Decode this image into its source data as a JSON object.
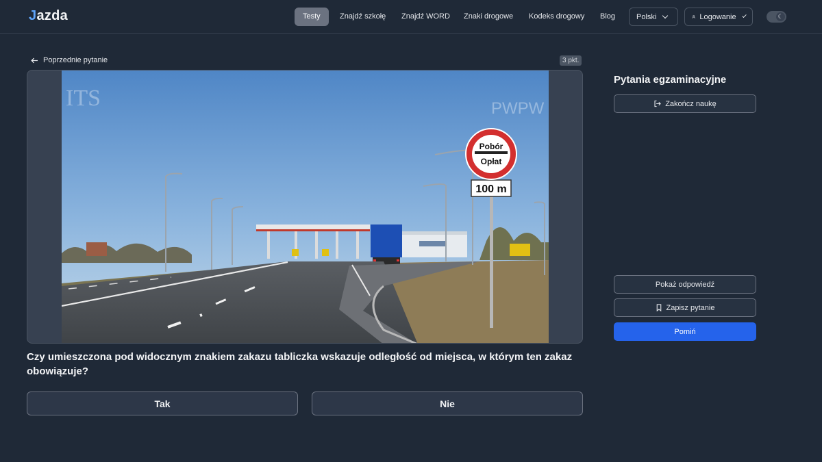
{
  "header": {
    "logo": {
      "initial": "J",
      "rest": "azda"
    },
    "nav": [
      {
        "label": "Testy",
        "active": true
      },
      {
        "label": "Znajdź szkołę"
      },
      {
        "label": "Znajdź WORD"
      },
      {
        "label": "Znaki drogowe"
      },
      {
        "label": "Kodeks drogowy"
      },
      {
        "label": "Blog"
      }
    ],
    "language_label": "Polski",
    "login_label": "Logowanie",
    "theme_icon": "moon-icon"
  },
  "question": {
    "prev_label": "Poprzednie pytanie",
    "points": "3 pkt.",
    "text": "Czy umieszczona pod widocznym znakiem zakazu tabliczka wskazuje odległość od miejsca, w którym ten zakaz obowiązuje?",
    "answers": [
      "Tak",
      "Nie"
    ],
    "image": {
      "sign_line1": "Pobór",
      "sign_line2": "Opłat",
      "plate": "100 m",
      "watermark_left": "ITS",
      "watermark_right": "PWPW"
    }
  },
  "sidebar": {
    "title": "Pytania egzaminacyjne",
    "finish_label": "Zakończ naukę",
    "show_answer_label": "Pokaż odpowiedź",
    "save_label": "Zapisz pytanie",
    "skip_label": "Pomiń"
  },
  "colors": {
    "background": "#1f2937",
    "primary": "#2563eb",
    "accent": "#60a5fa"
  }
}
